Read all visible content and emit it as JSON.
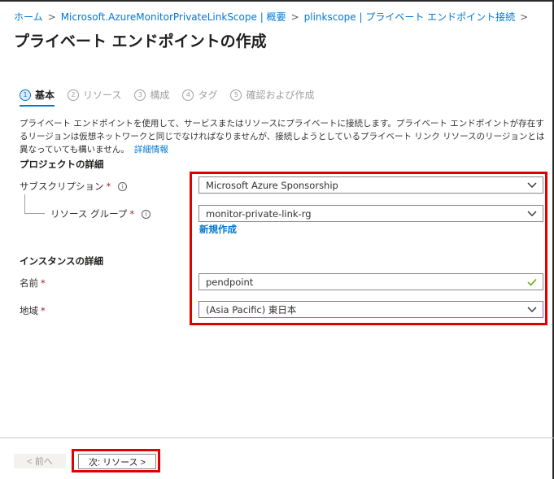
{
  "breadcrumb": {
    "items": [
      "ホーム",
      "Microsoft.AzureMonitorPrivateLinkScope | 概要",
      "plinkscope | プライベート エンドポイント接続"
    ],
    "separator": ">"
  },
  "page": {
    "title": "プライベート エンドポイントの作成"
  },
  "tabs": [
    {
      "num": "1",
      "label": "基本",
      "active": true
    },
    {
      "num": "2",
      "label": "リソース",
      "active": false
    },
    {
      "num": "3",
      "label": "構成",
      "active": false
    },
    {
      "num": "4",
      "label": "タグ",
      "active": false
    },
    {
      "num": "5",
      "label": "確認および作成",
      "active": false
    }
  ],
  "description": {
    "text": "プライベート エンドポイントを使用して、サービスまたはリソースにプライベートに接続します。プライベート エンドポイントが存在するリージョンは仮想ネットワークと同じでなければなりませんが、接続しようとしているプライベート リンク リソースのリージョンとは異なっていても構いません。",
    "link": "詳細情報"
  },
  "project": {
    "title": "プロジェクトの詳細",
    "subscription_label": "サブスクリプション",
    "subscription_value": "Microsoft Azure Sponsorship",
    "rg_label": "リソース グループ",
    "rg_value": "monitor-private-link-rg",
    "create_new": "新規作成",
    "required_mark": "*",
    "info_glyph": "i"
  },
  "instance": {
    "title": "インスタンスの詳細",
    "name_label": "名前",
    "name_value": "pendpoint",
    "region_label": "地域",
    "region_value": "(Asia Pacific) 東日本"
  },
  "footer": {
    "prev_label": "< 前へ",
    "next_label": "次: リソース >"
  },
  "colors": {
    "accent": "#0078d4",
    "highlight": "#e00000",
    "required": "#a4262c",
    "valid": "#57a300"
  }
}
